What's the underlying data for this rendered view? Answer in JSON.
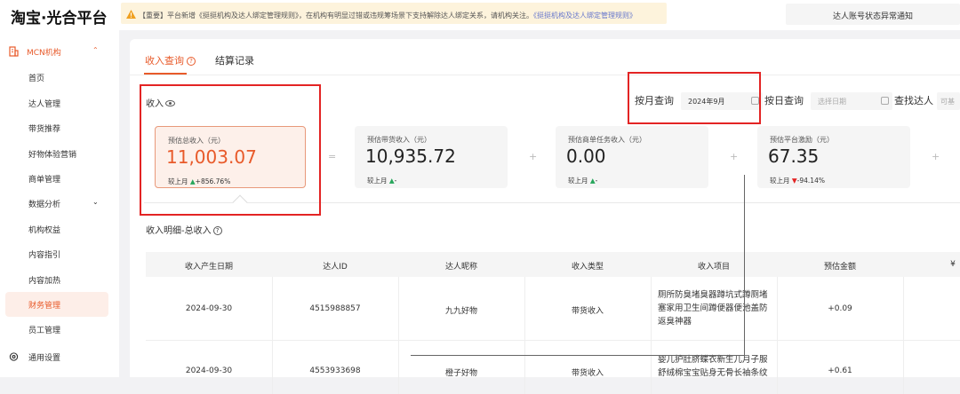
{
  "header": {
    "logo": "淘宝·光合平台",
    "notice_text": "【重要】平台新增《挺挺机构及达人绑定管理规则》，在机构有明显过错或违规筹场景下支持解除达人绑定关系，请机构关注。",
    "notice_link": "《挺挺机构及达人绑定管理规则》",
    "abnormal_notice": "达人账号状态异常通知"
  },
  "sidebar": {
    "group_label": "MCN机构",
    "items": [
      {
        "label": "首页"
      },
      {
        "label": "达人管理"
      },
      {
        "label": "带货推荐"
      },
      {
        "label": "好物体验营销"
      },
      {
        "label": "商单管理"
      },
      {
        "label": "数据分析"
      },
      {
        "label": "机构权益"
      },
      {
        "label": "内容指引"
      },
      {
        "label": "内容加热"
      },
      {
        "label": "财务管理"
      },
      {
        "label": "员工管理"
      }
    ],
    "settings_label": "通用设置"
  },
  "tabs": [
    {
      "label": "收入查询",
      "active": true
    },
    {
      "label": "结算记录",
      "active": false
    }
  ],
  "income": {
    "title": "收入",
    "filters": {
      "month_label": "按月查询",
      "month_value": "2024年9月",
      "day_label": "按日查询",
      "day_placeholder": "选择日期",
      "search_label": "查找达人",
      "search_placeholder": "可基"
    },
    "cards": [
      {
        "label": "预估总收入（元）",
        "value": "11,003.07",
        "compare_label": "较上月",
        "trend": "▲",
        "change": "+856.76%"
      },
      {
        "label": "预估带货收入（元）",
        "value": "10,935.72",
        "compare_label": "较上月",
        "trend": "▲",
        "change": "-"
      },
      {
        "label": "预估商单任务收入（元）",
        "value": "0.00",
        "compare_label": "较上月",
        "trend": "▲",
        "change": "-"
      },
      {
        "label": "预估平台激励（元）",
        "value": "67.35",
        "compare_label": "较上月",
        "trend": "▼",
        "change": "-94.14%"
      }
    ],
    "operators": [
      "=",
      "+",
      "+",
      "+"
    ]
  },
  "detail": {
    "title": "收入明细-总收入",
    "columns": [
      "收入产生日期",
      "达人ID",
      "达人昵称",
      "收入类型",
      "收入项目",
      "预估金额",
      "¥"
    ],
    "rows": [
      {
        "date": "2024-09-30",
        "id": "4515988857",
        "nickname": "九九好物",
        "type": "带货收入",
        "item_lines": [
          "厕所防臭堵臭器蹲坑式蹲厕堵",
          "塞家用卫生间蹲便器便池盖防",
          "返臭神器"
        ],
        "amount": "+0.09"
      },
      {
        "date": "2024-09-30",
        "id": "4553933698",
        "nickname": "橙子好物",
        "type": "带货收入",
        "item_lines": [
          "婴儿护肚脐蝶衣新生儿月子服",
          "舒绒棉宝宝贴身无骨长袖条纹"
        ],
        "amount": "+0.61"
      }
    ]
  },
  "colors": {
    "accent": "#e85a2a",
    "annotation_red": "#e32424",
    "up": "#26a65b"
  }
}
